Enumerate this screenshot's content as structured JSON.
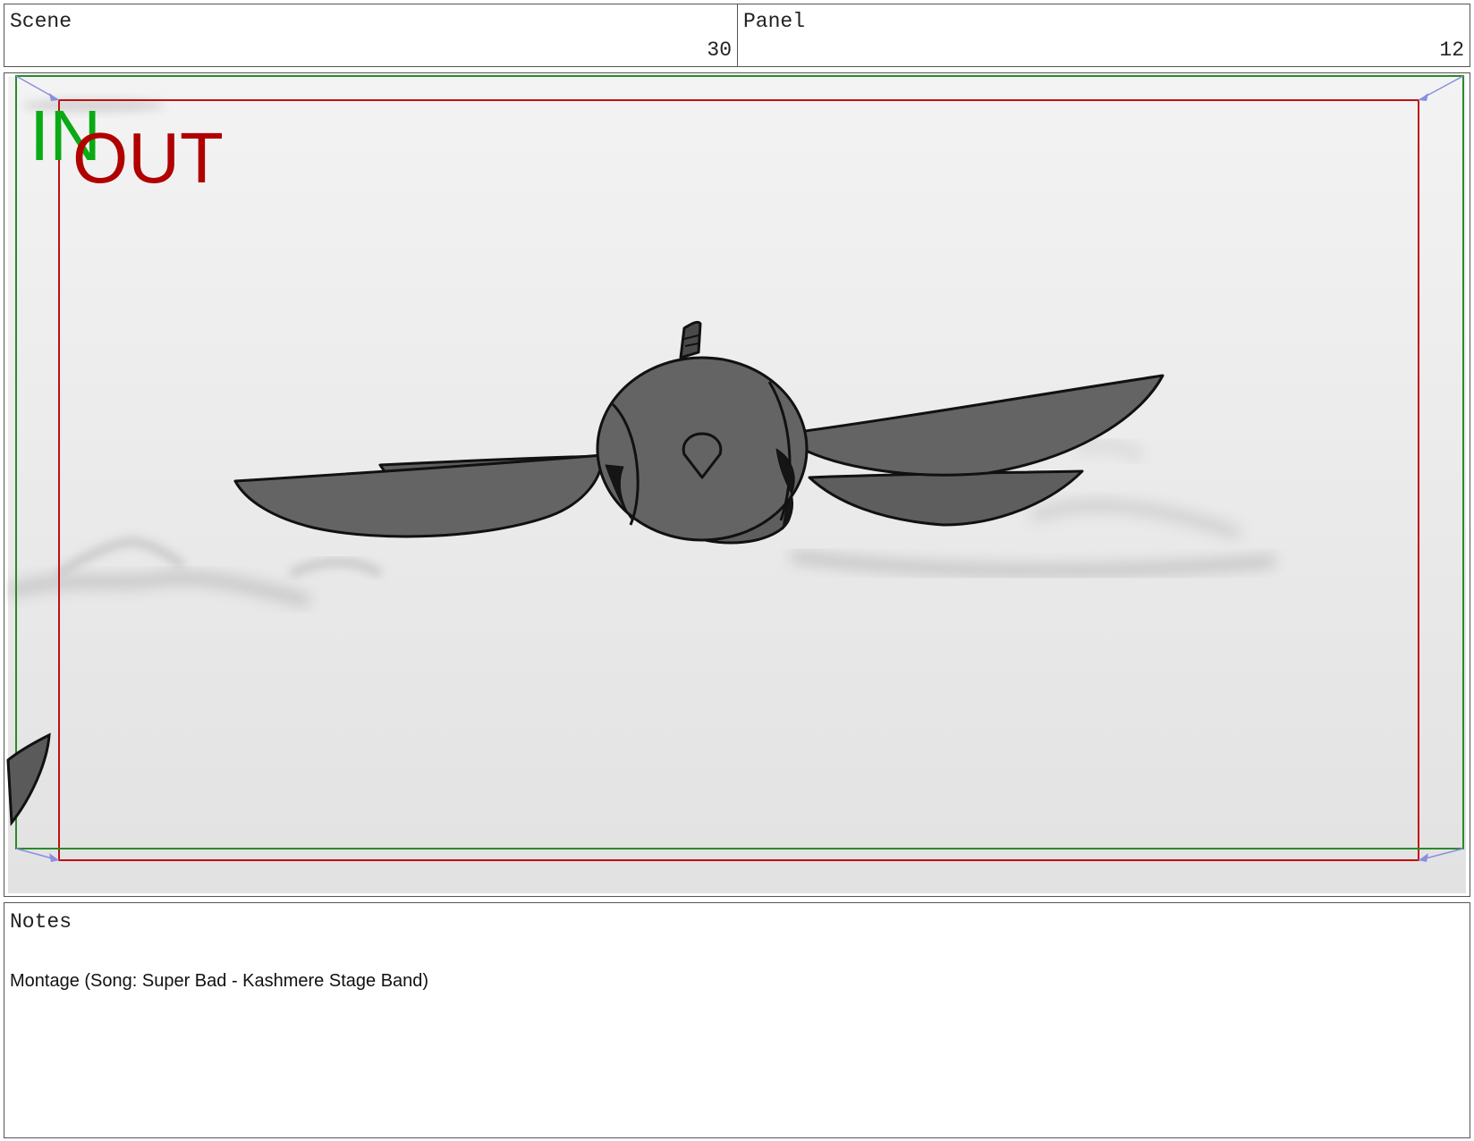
{
  "header": {
    "scene_label": "Scene",
    "scene_value": "30",
    "panel_label": "Panel",
    "panel_value": "12"
  },
  "frame": {
    "in_label": "IN",
    "out_label": "OUT",
    "in_color": "#0aaa14",
    "out_color": "#b00000",
    "subject": "bird-flying-toward-camera"
  },
  "notes": {
    "title": "Notes",
    "text": "Montage (Song: Super Bad - Kashmere Stage Band)"
  }
}
